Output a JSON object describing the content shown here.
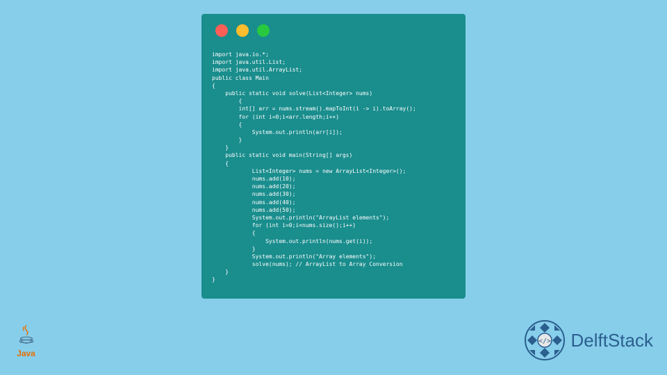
{
  "code": {
    "lines": [
      {
        "indent": 0,
        "text": "import java.io.*;"
      },
      {
        "indent": 0,
        "text": "import java.util.List;"
      },
      {
        "indent": 0,
        "text": "import java.util.ArrayList;"
      },
      {
        "indent": 0,
        "text": "public class Main"
      },
      {
        "indent": 0,
        "text": "{"
      },
      {
        "indent": 1,
        "text": "public static void solve(List<Integer> nums)"
      },
      {
        "indent": 2,
        "text": "{"
      },
      {
        "indent": 2,
        "text": "int[] arr = nums.stream().mapToInt(i -> i).toArray();"
      },
      {
        "indent": 2,
        "text": "for (int i=0;i<arr.length;i++)"
      },
      {
        "indent": 2,
        "text": "{"
      },
      {
        "indent": 3,
        "text": "System.out.println(arr[i]);"
      },
      {
        "indent": 2,
        "text": "}"
      },
      {
        "indent": 1,
        "text": "}"
      },
      {
        "indent": 1,
        "text": "public static void main(String[] args)"
      },
      {
        "indent": 1,
        "text": "{"
      },
      {
        "indent": 3,
        "text": "List<Integer> nums = new ArrayList<Integer>();"
      },
      {
        "indent": 3,
        "text": "nums.add(10);"
      },
      {
        "indent": 3,
        "text": "nums.add(20);"
      },
      {
        "indent": 3,
        "text": "nums.add(30);"
      },
      {
        "indent": 3,
        "text": "nums.add(40);"
      },
      {
        "indent": 3,
        "text": "nums.add(50);"
      },
      {
        "indent": 3,
        "text": "System.out.println(\"ArrayList elements\");"
      },
      {
        "indent": 3,
        "text": "for (int i=0;i<nums.size();i++)"
      },
      {
        "indent": 3,
        "text": "{"
      },
      {
        "indent": 4,
        "text": "System.out.println(nums.get(i));"
      },
      {
        "indent": 3,
        "text": "}"
      },
      {
        "indent": 3,
        "text": "System.out.println(\"Array elements\");"
      },
      {
        "indent": 3,
        "text": "solve(nums); // ArrayList to Array Conversion"
      },
      {
        "indent": 1,
        "text": "}"
      },
      {
        "indent": 0,
        "text": "}"
      }
    ]
  },
  "logos": {
    "java_text": "Java",
    "delftstack_text": "DelftStack"
  },
  "colors": {
    "background": "#87ceeb",
    "window_bg": "#1a8d8d",
    "red_btn": "#ff5f56",
    "yellow_btn": "#ffbd2e",
    "green_btn": "#27c93f"
  }
}
